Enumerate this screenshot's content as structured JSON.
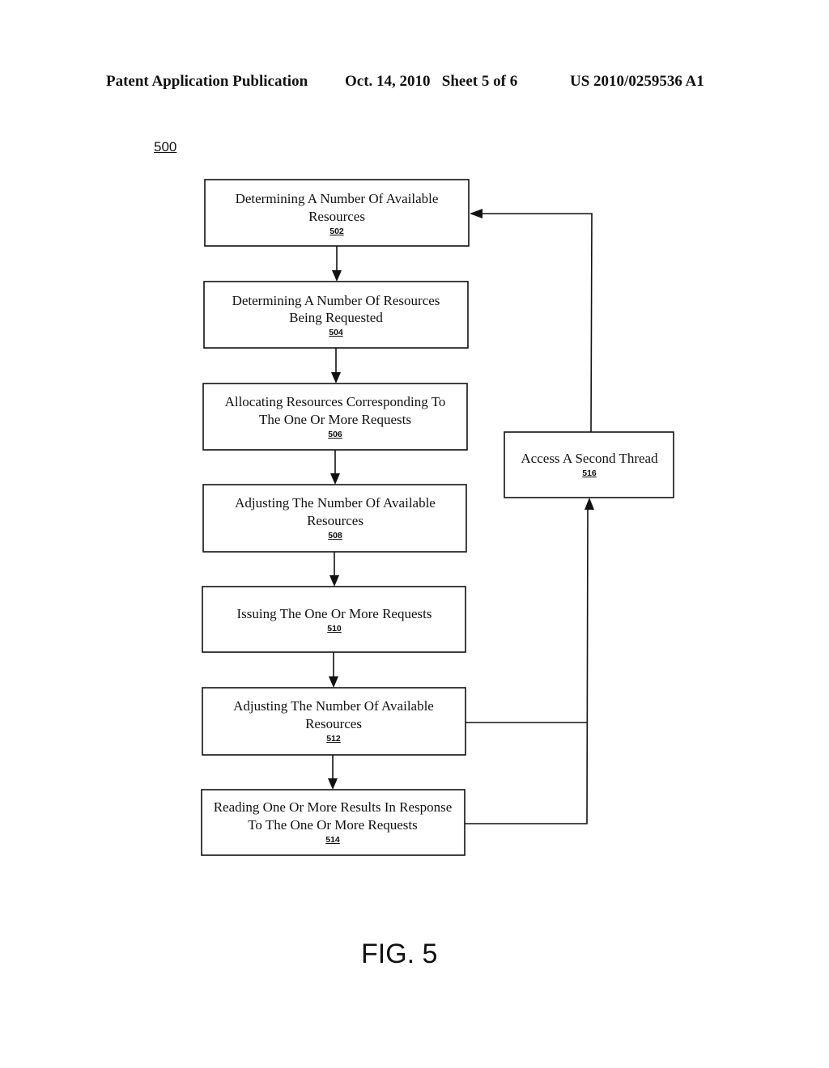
{
  "header": {
    "left": "Patent Application Publication",
    "middle": "Oct. 14, 2010   Sheet 5 of 6",
    "right": "US 2010/0259536 A1"
  },
  "figure_ref": "500",
  "figure_caption": "FIG. 5",
  "steps": [
    {
      "id": "502",
      "lines": [
        "Determining A Number Of Available",
        "Resources"
      ],
      "ref": "502"
    },
    {
      "id": "504",
      "lines": [
        "Determining A Number Of Resources",
        "Being Requested"
      ],
      "ref": "504"
    },
    {
      "id": "506",
      "lines": [
        "Allocating Resources Corresponding To",
        "The One Or More Requests"
      ],
      "ref": "506"
    },
    {
      "id": "508",
      "lines": [
        "Adjusting The Number Of Available",
        "Resources"
      ],
      "ref": "508"
    },
    {
      "id": "510",
      "lines": [
        "Issuing The One Or More Requests"
      ],
      "ref": "510"
    },
    {
      "id": "512",
      "lines": [
        "Adjusting The Number Of Available",
        "Resources"
      ],
      "ref": "512"
    },
    {
      "id": "514",
      "lines": [
        "Reading One Or More Results In Response",
        "To The One Or More Requests"
      ],
      "ref": "514"
    },
    {
      "id": "516",
      "lines": [
        "Access A Second Thread"
      ],
      "ref": "516"
    }
  ],
  "connections": [
    {
      "from": "502",
      "to": "504"
    },
    {
      "from": "504",
      "to": "506"
    },
    {
      "from": "506",
      "to": "508"
    },
    {
      "from": "508",
      "to": "510"
    },
    {
      "from": "510",
      "to": "512"
    },
    {
      "from": "512",
      "to": "514"
    },
    {
      "from": "512",
      "to": "516"
    },
    {
      "from": "514",
      "to": "516"
    },
    {
      "from": "516",
      "to": "502"
    }
  ]
}
